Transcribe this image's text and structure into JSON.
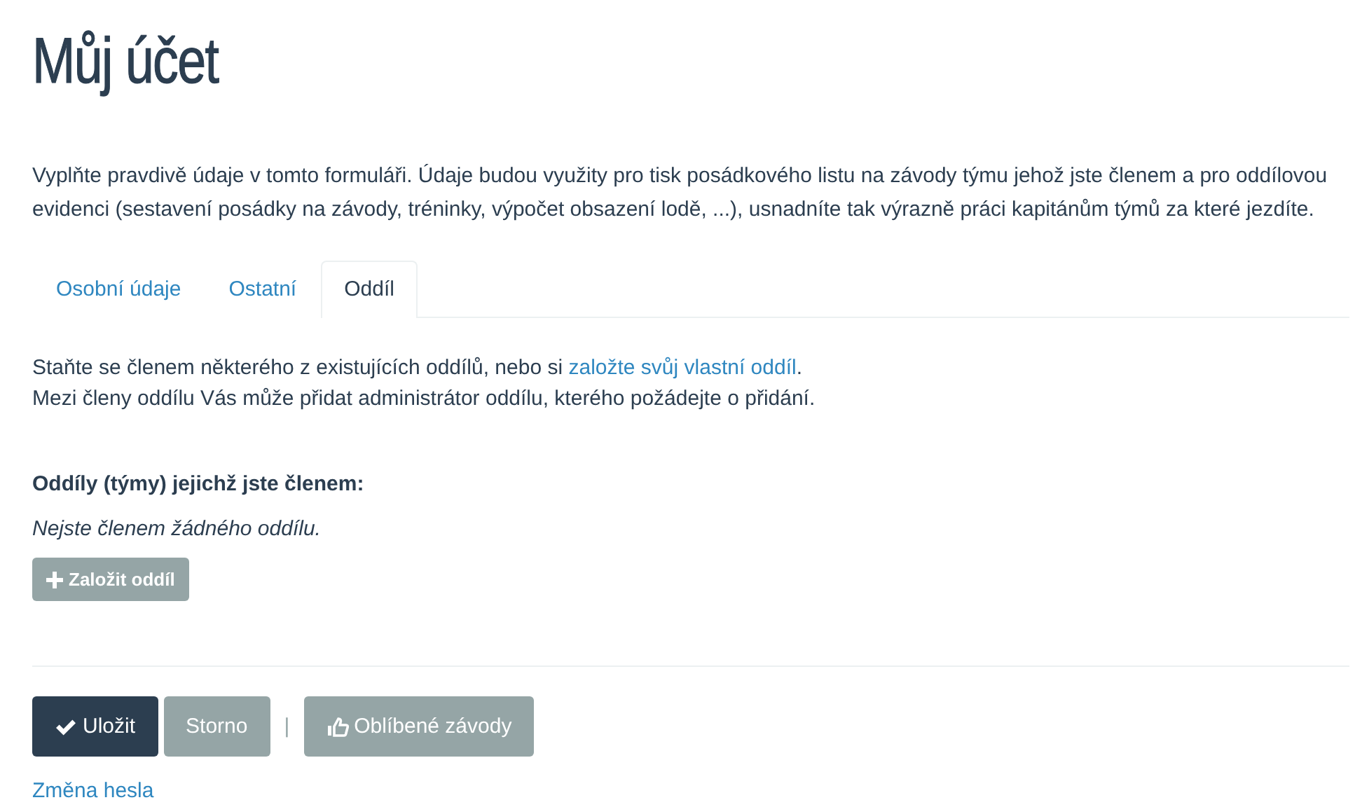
{
  "title": "Můj účet",
  "intro": "Vyplňte pravdivě údaje v tomto formuláři. Údaje budou využity pro tisk posádkového listu na závody týmu jehož jste členem a pro oddílovou evidenci (sestavení posádky na závody, tréninky, výpočet obsazení lodě, ...), usnadníte tak výrazně práci kapitánům týmů za které jezdíte.",
  "tabs": [
    {
      "label": "Osobní údaje",
      "selected": false
    },
    {
      "label": "Ostatní",
      "selected": false
    },
    {
      "label": "Oddíl",
      "selected": true
    }
  ],
  "notice": {
    "text_before": "Staňte se členem některého z existujících oddílů, nebo si ",
    "link": "založte svůj vlastní oddíl",
    "text_after": ".",
    "second_line": "Mezi členy oddílu Vás může přidat administrátor oddílu, kterého požádejte o přidání."
  },
  "teams": {
    "heading": "Oddíly (týmy) jejichž jste členem:",
    "empty_message": "Nejste členem žádného oddílu.",
    "create_button": "Založit oddíl"
  },
  "actions": [
    {
      "kind": "save",
      "label": "Uložit"
    },
    {
      "kind": "cancel",
      "label": "Storno"
    },
    {
      "kind": "separator",
      "label": "|"
    },
    {
      "kind": "favorites",
      "label": "Oblíbené závody"
    }
  ],
  "password_link": "Změna hesla"
}
